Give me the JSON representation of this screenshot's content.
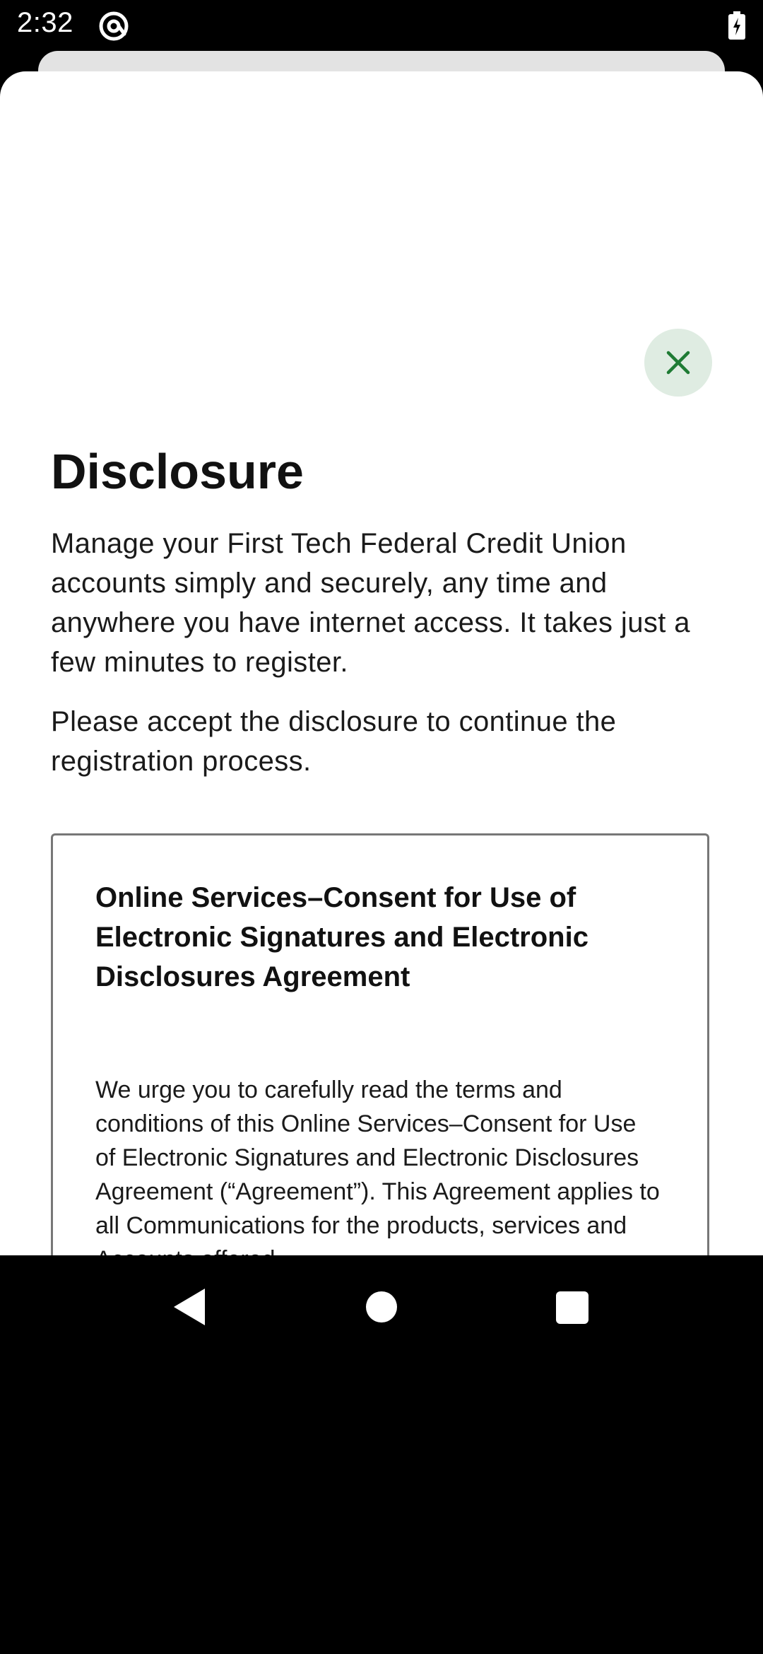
{
  "status_bar": {
    "time": "2:32",
    "app_icon": "at-sign-icon",
    "battery_icon": "battery-charging-icon"
  },
  "sheet": {
    "close_icon": "close-icon",
    "accent_color": "#1e7b34",
    "close_bg_color": "#dfece2",
    "title": "Disclosure",
    "intro_paragraph_1": "Manage your First Tech Federal Credit Union accounts simply and securely, any time and anywhere you have internet access. It takes just a few minutes to register.",
    "intro_paragraph_2": "Please accept the disclosure to continue the registration process.",
    "disclosure": {
      "heading": "Online Services–Consent for Use of Electronic Signatures and Electronic Disclosures Agreement",
      "body": "We urge you to carefully read the terms and conditions of this Online Services–Consent for Use of Electronic Signatures and Electronic Disclosures Agreement (“Agreement”). This Agreement applies to all Communications for the products, services and Accounts offered"
    }
  },
  "nav_bar": {
    "back_icon": "back-triangle-icon",
    "home_icon": "home-circle-icon",
    "recents_icon": "recents-square-icon"
  }
}
